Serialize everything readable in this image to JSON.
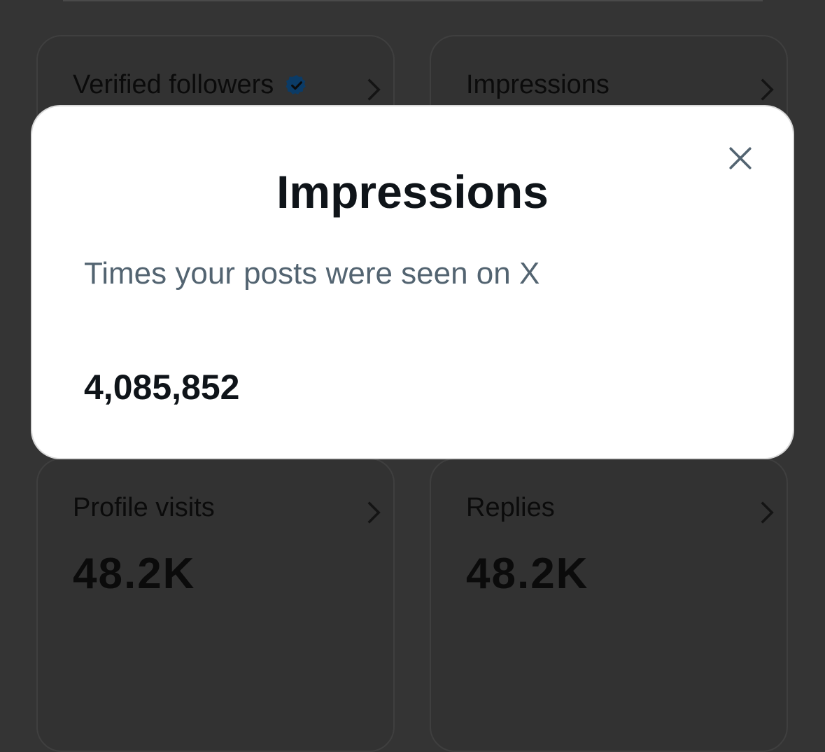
{
  "cards": {
    "verified_followers": {
      "label": "Verified followers",
      "value": ""
    },
    "impressions": {
      "label": "Impressions",
      "value": ""
    },
    "profile_visits": {
      "label": "Profile visits",
      "value": "48.2K"
    },
    "replies": {
      "label": "Replies",
      "value": "48.2K"
    }
  },
  "modal": {
    "title": "Impressions",
    "description": "Times your posts were seen on X",
    "value": "4,085,852"
  },
  "colors": {
    "verified_badge": "#1d9bf0",
    "backdrop": "#343434"
  }
}
